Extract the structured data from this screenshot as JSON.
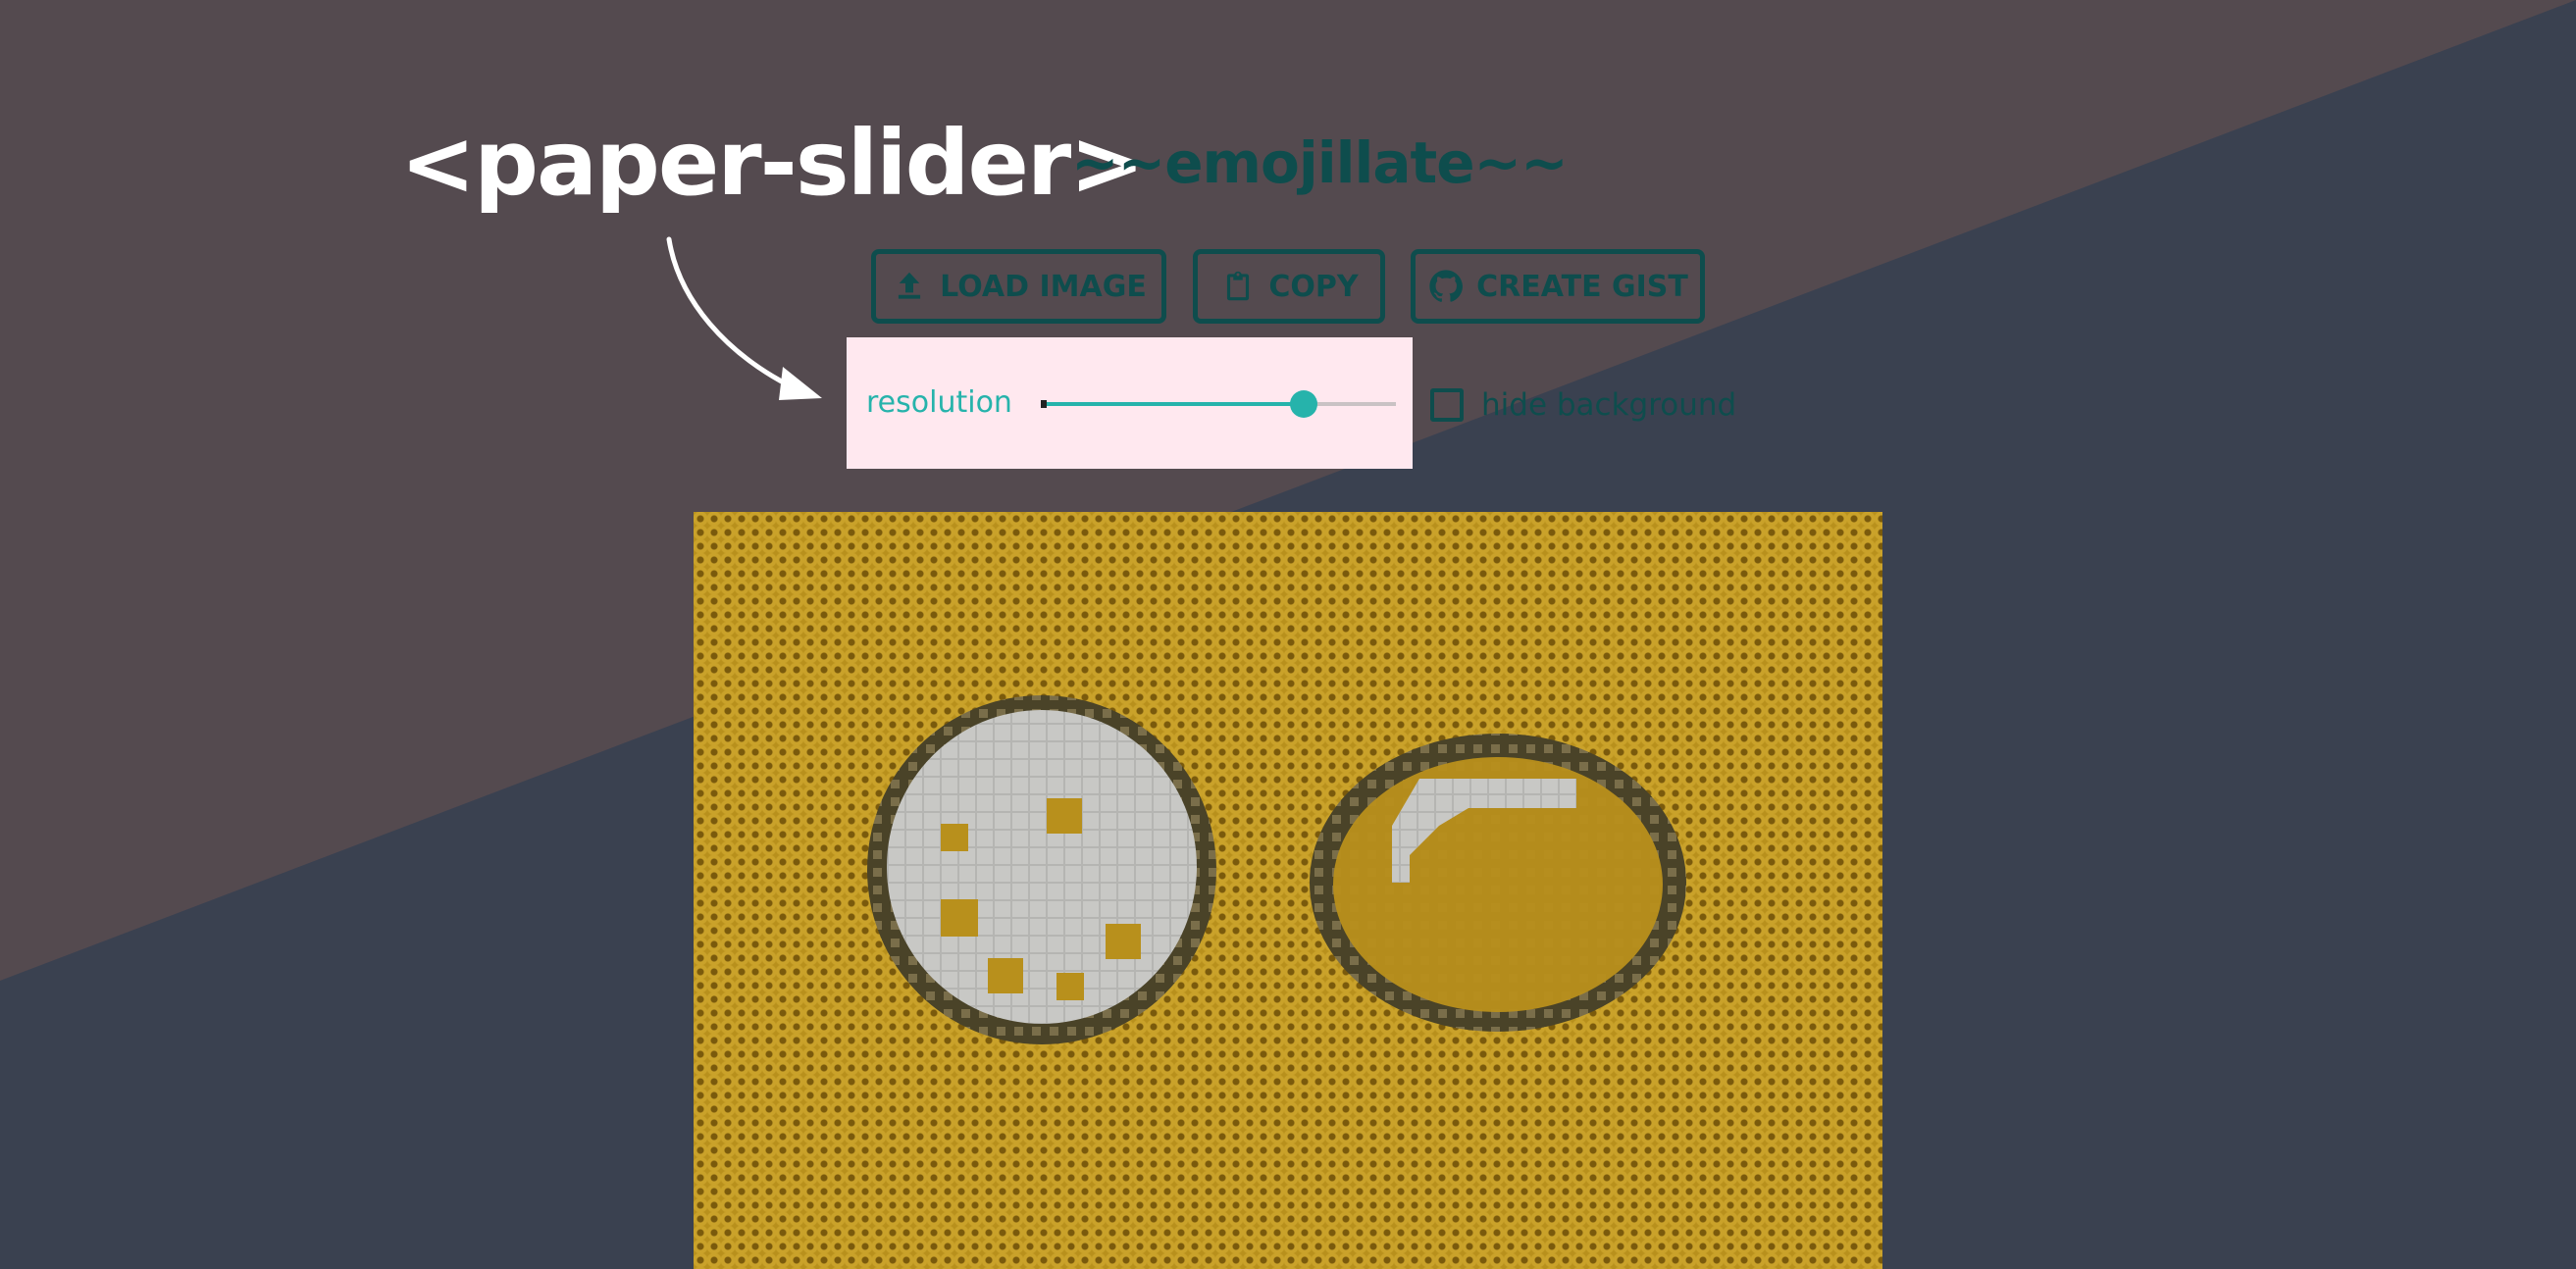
{
  "header": {
    "title": "<paper-slider>",
    "subtitle": "~~emojillate~~"
  },
  "toolbar": {
    "load_label": "LOAD IMAGE",
    "copy_label": "COPY",
    "gist_label": "CREATE GIST",
    "load_icon": "upload-icon",
    "copy_icon": "clipboard-icon",
    "gist_icon": "github-icon"
  },
  "controls": {
    "resolution_label": "resolution",
    "resolution_value": 0.74,
    "hide_background_label": "hide background",
    "hide_background_checked": false
  },
  "colors": {
    "background_top": "#544a4f",
    "background_bottom": "#3a4150",
    "accent": "#26b3ab",
    "dark_teal": "#0e4d4d",
    "panel": "#ffe8ef",
    "mosaic": "#b8901c"
  }
}
